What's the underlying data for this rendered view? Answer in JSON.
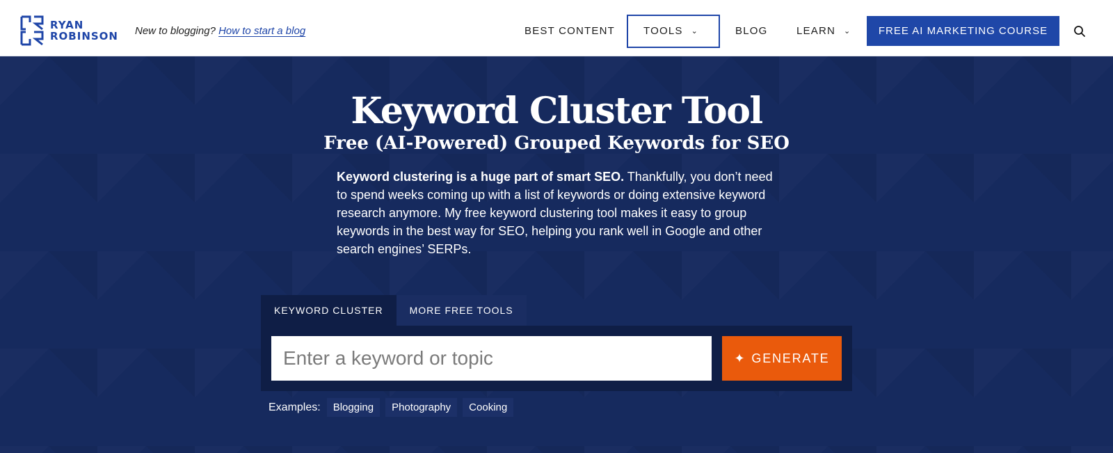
{
  "brand": {
    "line1": "RYAN",
    "line2": "ROBINSON"
  },
  "tagline": {
    "prefix": "New to blogging?",
    "link": "How to start a blog"
  },
  "nav": {
    "best_content": "BEST CONTENT",
    "tools": "TOOLS",
    "blog": "BLOG",
    "learn": "LEARN",
    "cta": "FREE AI MARKETING COURSE"
  },
  "hero": {
    "title": "Keyword Cluster Tool",
    "subtitle": "Free (AI-Powered) Grouped Keywords for SEO",
    "intro_bold": "Keyword clustering is a huge part of smart SEO.",
    "intro_rest": " Thankfully, you don’t need to spend weeks coming up with a list of keywords or doing extensive keyword research anymore. My free keyword clustering tool makes it easy to group keywords in the best way for SEO, helping you rank well in Google and other search engines’ SERPs."
  },
  "tabs": [
    {
      "label": "KEYWORD CLUSTER",
      "active": true
    },
    {
      "label": "MORE FREE TOOLS",
      "active": false
    }
  ],
  "form": {
    "placeholder": "Enter a keyword or topic",
    "value": "",
    "button": "GENERATE"
  },
  "examples": {
    "label": "Examples:",
    "items": [
      "Blogging",
      "Photography",
      "Cooking"
    ]
  },
  "colors": {
    "brand_blue": "#1e45a8",
    "hero_bg": "#162a5e",
    "generate_orange": "#ea5a0c"
  }
}
